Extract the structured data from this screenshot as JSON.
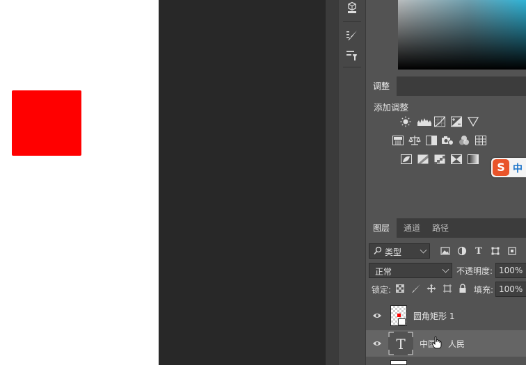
{
  "colors": {
    "canvas": "#ffffff",
    "shape_fill": "#ff0000",
    "pasteboard": "#282828",
    "panel_bg": "#535353",
    "tabbar_bg": "#3c3c3c",
    "ime_accent": "#e9542a"
  },
  "icon_strip": {
    "items": [
      "cube-3d-icon",
      "brush-settings-icon",
      "tool-presets-icon"
    ]
  },
  "adjustments_panel": {
    "tab_label": "调整",
    "title": "添加调整",
    "icons_row1": [
      "brightness-contrast-icon",
      "levels-icon",
      "curves-icon",
      "exposure-icon",
      "gradient-map-triangle-icon"
    ],
    "icons_row2": [
      "vibrance-icon",
      "color-balance-icon",
      "black-white-icon",
      "photo-filter-icon",
      "channel-mixer-icon",
      "color-lookup-icon"
    ],
    "icons_row3": [
      "invert-icon",
      "posterize-icon",
      "threshold-icon",
      "selective-color-icon",
      "gradient-map-icon"
    ]
  },
  "ime": {
    "logo": "S",
    "mode": "中"
  },
  "layers_panel": {
    "tabs": [
      "图层",
      "通道",
      "路径"
    ],
    "active_tab": 0,
    "filter": {
      "label": "类型",
      "icons": [
        "pixel-filter-icon",
        "adjustment-filter-icon",
        "type-filter-icon",
        "shape-filter-icon",
        "smart-filter-icon"
      ]
    },
    "blend_mode": "正常",
    "opacity_label": "不透明度:",
    "opacity_value": "100%",
    "lock_label": "锁定:",
    "lock_icons": [
      "lock-transparent-icon",
      "lock-pixels-icon",
      "lock-position-icon",
      "lock-artboard-icon",
      "lock-all-icon"
    ],
    "fill_label": "填充:",
    "fill_value": "100%",
    "layers": [
      {
        "name": "圆角矩形 1",
        "type": "shape"
      },
      {
        "name": "中国",
        "name2": "人民",
        "type": "text"
      }
    ]
  }
}
